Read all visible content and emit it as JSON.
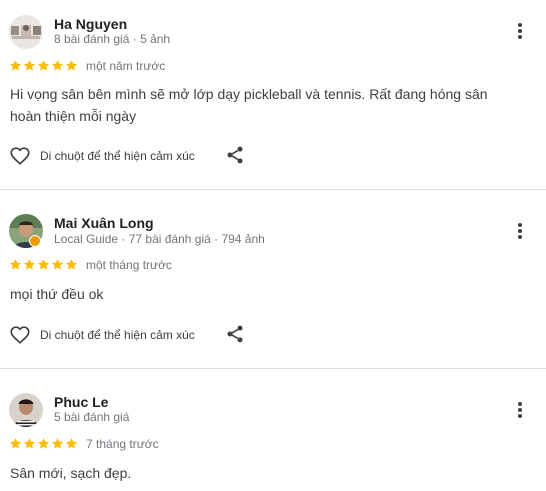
{
  "reviews": [
    {
      "name": "Ha Nguyen",
      "meta": "8 bài đánh giá · 5 ảnh",
      "rating": 5,
      "time": "một năm trước",
      "text": "Hi vọng sân bên mình sẽ mở lớp dạy pickleball và tennis. Rất đang hóng sân hoàn thiện mỗi ngày",
      "like_label": "Di chuột để thể hiện cảm xúc"
    },
    {
      "name": "Mai Xuân Long",
      "meta": "Local Guide · 77 bài đánh giá · 794 ảnh",
      "rating": 5,
      "time": "một tháng trước",
      "text": "mọi thứ đều ok",
      "like_label": "Di chuột để thể hiện cảm xúc"
    },
    {
      "name": "Phuc Le",
      "meta": "5 bài đánh giá",
      "rating": 5,
      "time": "7 tháng trước",
      "text": "Sân mới, sạch đẹp."
    }
  ],
  "colors": {
    "star": "#fbbc04",
    "name": "#202124",
    "secondary": "#70757a",
    "body_text": "#3c4043",
    "divider": "#dadce0",
    "local_guide_badge": "#f29900"
  },
  "icons": {
    "more": "more-vert-icon",
    "like": "heart-outline-icon",
    "share": "share-icon",
    "star": "star-filled-icon",
    "badge": "local-guide-badge-icon"
  }
}
